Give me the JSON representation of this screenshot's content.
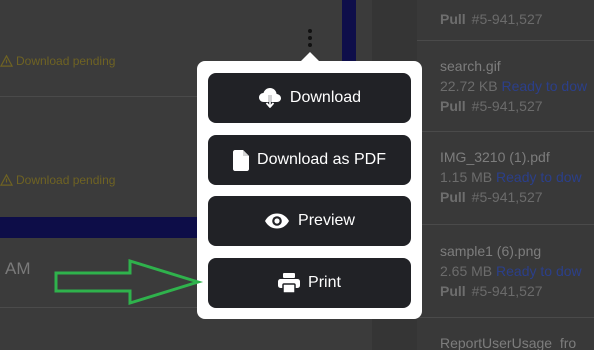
{
  "background": {
    "pending_items": [
      {
        "label": "Download pending"
      },
      {
        "label": "Download pending"
      }
    ],
    "time_fragment": "AM"
  },
  "files": [
    {
      "name": "",
      "size": "",
      "status": "",
      "pull_label": "Pull",
      "pull_id": "#5-941,527"
    },
    {
      "name": "search.gif",
      "size": "22.72 KB",
      "status": "Ready to dow",
      "pull_label": "Pull",
      "pull_id": "#5-941,527"
    },
    {
      "name": "IMG_3210 (1).pdf",
      "size": "1.15 MB",
      "status": "Ready to dow",
      "pull_label": "Pull",
      "pull_id": "#5-941,527"
    },
    {
      "name": "sample1 (6).png",
      "size": "2.65 MB",
      "status": "Ready to dow",
      "pull_label": "Pull",
      "pull_id": "#5-941,527"
    },
    {
      "name": "ReportUserUsage_fro",
      "size": "",
      "status": "",
      "pull_label": "",
      "pull_id": ""
    }
  ],
  "menu": {
    "items": [
      {
        "label": "Download",
        "icon": "cloud-download-icon"
      },
      {
        "label": "Download as PDF",
        "icon": "file-icon"
      },
      {
        "label": "Preview",
        "icon": "eye-icon"
      },
      {
        "label": "Print",
        "icon": "printer-icon"
      }
    ]
  },
  "colors": {
    "menu_button_bg": "#212226",
    "annotation_arrow": "#2fb24c",
    "pending_text": "#6f6323",
    "status_link": "#2b3f8a"
  }
}
